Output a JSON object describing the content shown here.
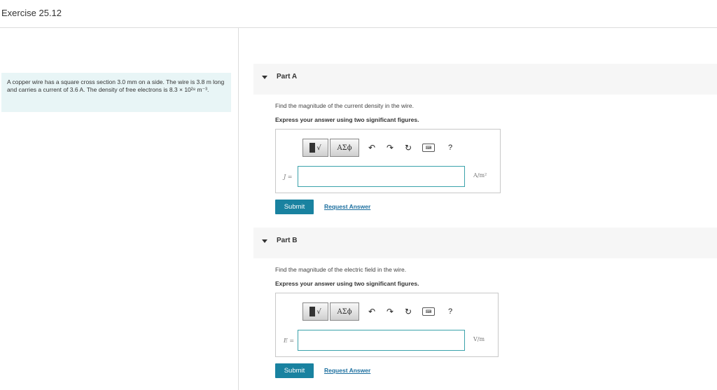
{
  "header": {
    "title": "Exercise 25.12"
  },
  "problem": {
    "text": "A copper wire has a square cross section 3.0 mm on a side. The wire is 3.8 m long and carries a current of 3.6 A. The density of free electrons is 8.3 × 10²⁸ m⁻³."
  },
  "toolbar": {
    "templates_label": "√",
    "greek_label": "ΑΣϕ",
    "undo_icon": "undo-icon",
    "redo_icon": "redo-icon",
    "reset_icon": "reset-icon",
    "keyboard_icon": "keyboard-icon",
    "help_label": "?"
  },
  "parts": [
    {
      "label": "Part A",
      "question": "Find the magnitude of the current density in the wire.",
      "instruction": "Express your answer using two significant figures.",
      "variable": "J =",
      "input_value": "",
      "unit": "A/m²",
      "submit_label": "Submit",
      "request_label": "Request Answer"
    },
    {
      "label": "Part B",
      "question": "Find the magnitude of the electric field in the wire.",
      "instruction": "Express your answer using two significant figures.",
      "variable": "E =",
      "input_value": "",
      "unit": "V/m",
      "submit_label": "Submit",
      "request_label": "Request Answer"
    }
  ],
  "colors": {
    "accent": "#1982a0",
    "problem_bg": "#e8f5f6",
    "link": "#1c6f9f",
    "input_border": "#3aa2ab"
  }
}
